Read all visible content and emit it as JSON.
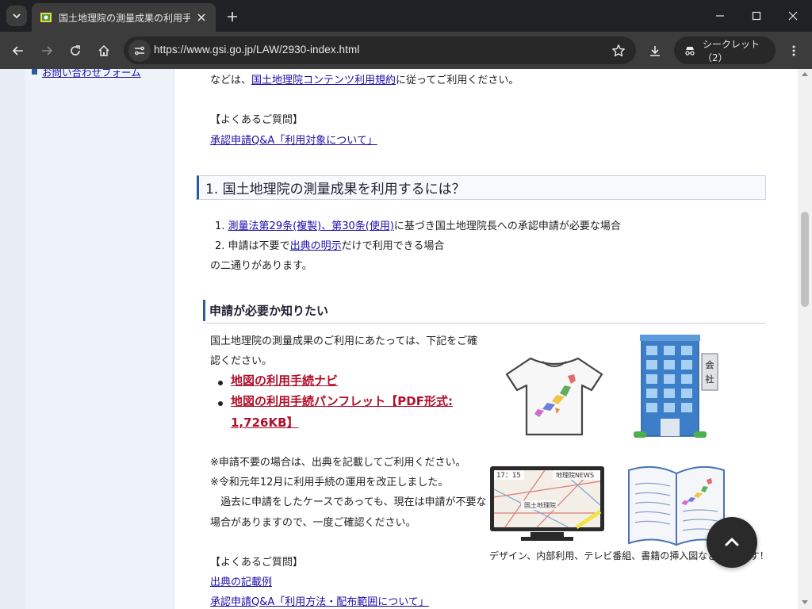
{
  "browser": {
    "tab_title": "国土地理院の測量成果の利用手続",
    "url": "https://www.gsi.go.jp/LAW/2930-index.html",
    "incognito_label": "シークレット（2）"
  },
  "sidebar": {
    "items": [
      {
        "label": "お問い合わせフォーム"
      }
    ]
  },
  "content": {
    "intro_prefix": "などは、",
    "intro_link": "国土地理院コンテンツ利用規約",
    "intro_suffix": "に従ってご利用ください。",
    "faq1_heading": "【よくあるご質問】",
    "faq1_link": "承認申請Q&A「利用対象について」",
    "section1_title": "1. 国土地理院の測量成果を利用するには？",
    "list": [
      {
        "num": "1.",
        "link": "測量法第29条(複製)、第30条(使用)",
        "text": "に基づき国土地理院長への承認申請が必要な場合"
      },
      {
        "num": "2.",
        "prefix": "申請は不要で",
        "link": "出典の明示",
        "text": "だけで利用できる場合"
      }
    ],
    "list_tail": "の二通りがあります。",
    "subsection_title": "申請が必要か知りたい",
    "desc_line1": "国土地理院の測量成果のご利用にあたっては、下記をご確",
    "desc_line2": "認ください。",
    "red_links": [
      {
        "label": "地図の利用手続ナビ"
      },
      {
        "label_line1": "地図の利用手続パンフレット【PDF形式:",
        "label_line2": "1,726KB】"
      }
    ],
    "note1": "※申請不要の場合は、出典を記載してご利用ください。",
    "note2": "※令和元年12月に利用手続の運用を改正しました。",
    "note3": "　過去に申請をしたケースであっても、現在は申請が不要な",
    "note4": "場合がありますので、一度ご確認ください。",
    "faq2_heading": "【よくあるご質問】",
    "faq2_link1": "出典の記載例",
    "faq2_link2": "承認申請Q&A「利用方法・配布範囲について」",
    "image_caption": "デザイン、内部利用、テレビ番組、書籍の挿入図などはOKです！",
    "tv_news_label": "地理院NEWS",
    "tv_time": "17：15",
    "tv_map_label": "国土地理院",
    "building_sign": "会社"
  },
  "colors": {
    "accent": "#2c5aa0",
    "link": "#1a0dab",
    "red_link": "#b0102a"
  }
}
